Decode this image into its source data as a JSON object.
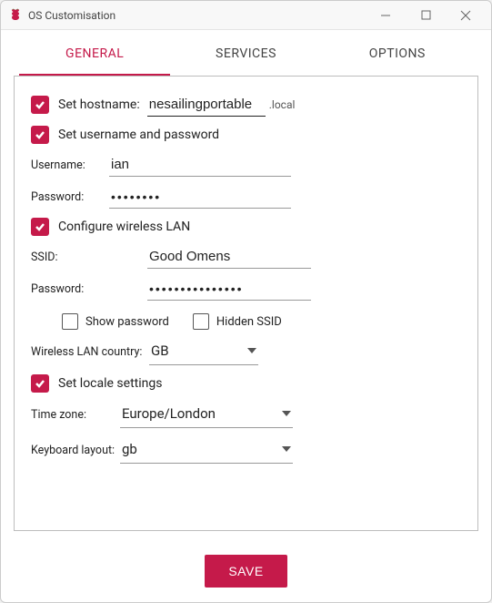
{
  "window": {
    "title": "OS Customisation"
  },
  "tabs": {
    "general": "GENERAL",
    "services": "SERVICES",
    "options": "OPTIONS",
    "active": "general"
  },
  "hostname": {
    "section_label": "Set hostname:",
    "value": "nesailingportable",
    "suffix": ".local"
  },
  "user": {
    "section_label": "Set username and password",
    "username_label": "Username:",
    "username_value": "ian",
    "password_label": "Password:",
    "password_value": "••••••••"
  },
  "wifi": {
    "section_label": "Configure wireless LAN",
    "ssid_label": "SSID:",
    "ssid_value": "Good Omens",
    "password_label": "Password:",
    "password_value": "•••••••••••••••",
    "show_password_label": "Show password",
    "hidden_ssid_label": "Hidden SSID",
    "country_label": "Wireless LAN country:",
    "country_value": "GB"
  },
  "locale": {
    "section_label": "Set locale settings",
    "timezone_label": "Time zone:",
    "timezone_value": "Europe/London",
    "keyboard_label": "Keyboard layout:",
    "keyboard_value": "gb"
  },
  "footer": {
    "save_label": "SAVE"
  },
  "colors": {
    "accent": "#c51a4a"
  }
}
